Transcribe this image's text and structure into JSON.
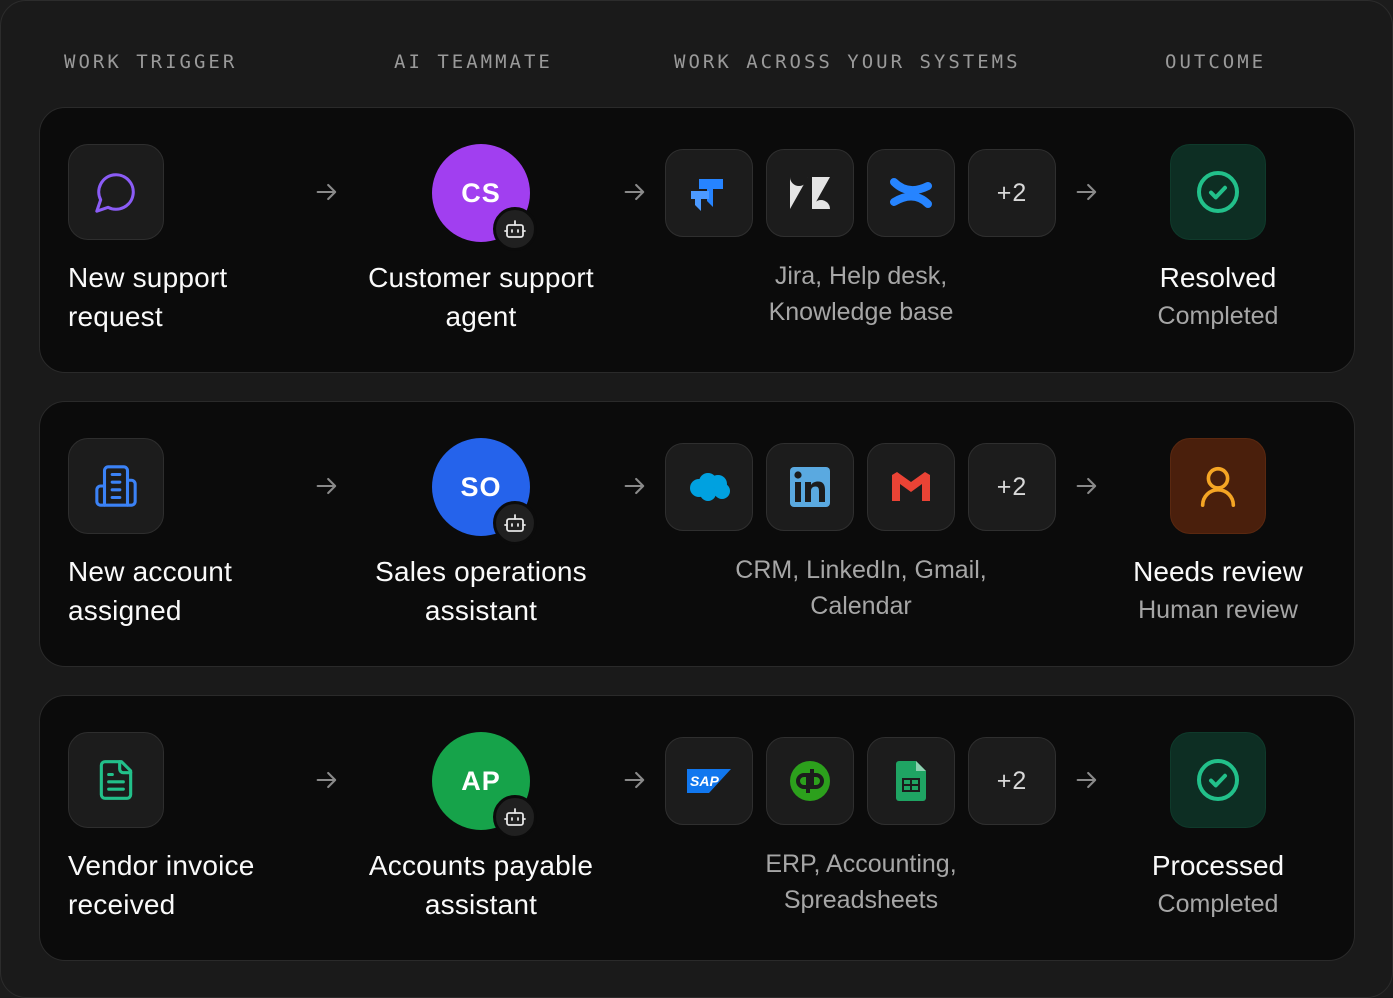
{
  "headers": {
    "trigger": "WORK TRIGGER",
    "teammate": "AI TEAMMATE",
    "systems": "WORK ACROSS YOUR SYSTEMS",
    "outcome": "OUTCOME"
  },
  "rows": [
    {
      "trigger": {
        "icon": "chat-bubble-icon",
        "line1": "New support",
        "line2": "request"
      },
      "teammate": {
        "initials": "CS",
        "line1": "Customer support",
        "line2": "agent",
        "color": "#a13ff0"
      },
      "systems": {
        "icons": [
          "jira-icon",
          "zendesk-icon",
          "confluence-icon"
        ],
        "more": "+2",
        "line1": "Jira, Help desk,",
        "line2": "Knowledge base"
      },
      "outcome": {
        "icon": "check-circle-icon",
        "title": "Resolved",
        "subtitle": "Completed",
        "color": "#22c08a"
      }
    },
    {
      "trigger": {
        "icon": "building-icon",
        "line1": "New account",
        "line2": "assigned"
      },
      "teammate": {
        "initials": "SO",
        "line1": "Sales operations",
        "line2": "assistant",
        "color": "#2563eb"
      },
      "systems": {
        "icons": [
          "salesforce-icon",
          "linkedin-icon",
          "gmail-icon"
        ],
        "more": "+2",
        "line1": "CRM, LinkedIn, Gmail,",
        "line2": "Calendar"
      },
      "outcome": {
        "icon": "user-icon",
        "title": "Needs review",
        "subtitle": "Human review",
        "color": "#f5a524"
      }
    },
    {
      "trigger": {
        "icon": "document-icon",
        "line1": "Vendor invoice",
        "line2": "received"
      },
      "teammate": {
        "initials": "AP",
        "line1": "Accounts payable",
        "line2": "assistant",
        "color": "#16a34a"
      },
      "systems": {
        "icons": [
          "sap-icon",
          "quickbooks-icon",
          "google-sheets-icon"
        ],
        "more": "+2",
        "line1": "ERP, Accounting,",
        "line2": "Spreadsheets"
      },
      "outcome": {
        "icon": "check-circle-icon",
        "title": "Processed",
        "subtitle": "Completed",
        "color": "#22c08a"
      }
    }
  ]
}
